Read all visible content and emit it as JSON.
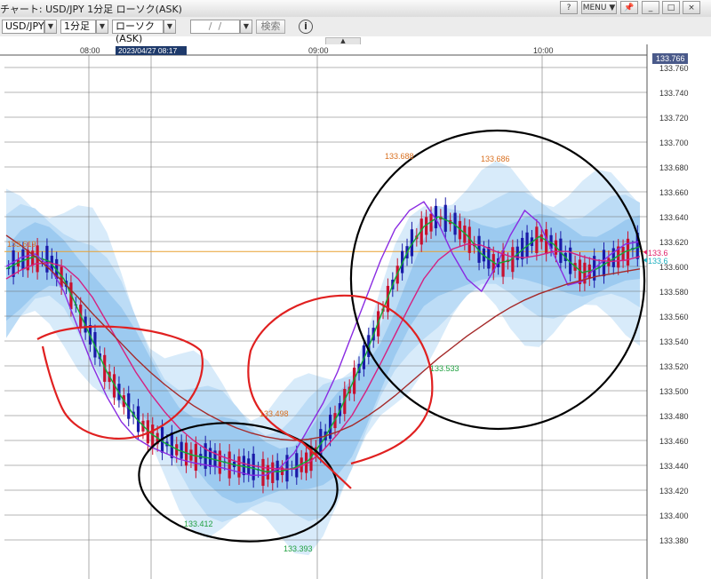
{
  "window": {
    "title": "チャート: USD/JPY 1分足 ローソク(ASK)",
    "help_label": "?",
    "menu_label": "MENU ▼",
    "pin_label": "📌",
    "minimize_label": "_",
    "maximize_label": "□",
    "close_label": "×"
  },
  "toolbar": {
    "pair": "USD/JPY",
    "timeframe": "1分足",
    "candle_type": "ローソク(ASK)",
    "date_value": " /  / ",
    "search_label": "検索",
    "info_label": "i",
    "dropdown_glyph": "▼",
    "collapse_glyph": "▲"
  },
  "chart_data": {
    "type": "candlestick",
    "x_ticks": [
      "08:00",
      "09:00",
      "10:00"
    ],
    "cursor_time": "2023/04/27 08:17",
    "y_ticks": [
      "133.760",
      "133.740",
      "133.720",
      "133.700",
      "133.680",
      "133.660",
      "133.640",
      "133.620",
      "133.600",
      "133.580",
      "133.560",
      "133.540",
      "133.520",
      "133.500",
      "133.480",
      "133.460",
      "133.440",
      "133.420",
      "133.400",
      "133.380"
    ],
    "ylim": [
      133.37,
      133.77
    ],
    "current_price": "133.766",
    "price_tags": [
      "133.6",
      "133.6"
    ],
    "reference_line": 133.612,
    "annotations": {
      "left_level": "133.619",
      "high_1": "133.688",
      "high_2": "133.686",
      "mid_high": "133.498",
      "low_1": "133.412",
      "low_2": "133.393",
      "pullback_low": "133.533"
    },
    "series": [
      {
        "name": "",
        "color": "#11aa33",
        "values": [
          133.598,
          133.604,
          133.608,
          133.604,
          133.59,
          133.565,
          133.54,
          133.515,
          133.495,
          133.478,
          133.466,
          133.458,
          133.452,
          133.448,
          133.446,
          133.443,
          133.44,
          133.438,
          133.435,
          133.435,
          133.438,
          133.444,
          133.46,
          133.48,
          133.505,
          133.53,
          133.56,
          133.59,
          133.615,
          133.632,
          133.64,
          133.635,
          133.625,
          133.61,
          133.602,
          133.605,
          133.615,
          133.624,
          133.618,
          133.605,
          133.595,
          133.598,
          133.605,
          133.612,
          133.616
        ]
      },
      {
        "name": "",
        "color": "#8a2be2",
        "values": [
          133.6,
          133.607,
          133.61,
          133.6,
          133.58,
          133.55,
          133.52,
          133.495,
          133.475,
          133.462,
          133.455,
          133.45,
          133.445,
          133.442,
          133.44,
          133.438,
          133.435,
          133.432,
          133.432,
          133.438,
          133.45,
          133.47,
          133.49,
          133.515,
          133.545,
          133.575,
          133.605,
          133.63,
          133.645,
          133.652,
          133.635,
          133.61,
          133.59,
          133.58,
          133.6,
          133.625,
          133.645,
          133.635,
          133.61,
          133.585,
          133.588,
          133.6,
          133.61,
          133.618,
          133.62
        ]
      },
      {
        "name": "",
        "color": "#d62080",
        "values": [
          133.59,
          133.597,
          133.602,
          133.603,
          133.6,
          133.59,
          133.575,
          133.555,
          133.535,
          133.515,
          133.498,
          133.483,
          133.47,
          133.46,
          133.452,
          133.447,
          133.443,
          133.44,
          133.438,
          133.437,
          133.437,
          133.442,
          133.452,
          133.465,
          133.48,
          133.5,
          133.522,
          133.545,
          133.568,
          133.59,
          133.605,
          133.614,
          133.618,
          133.617,
          133.612,
          133.608,
          133.607,
          133.609,
          133.612,
          133.612,
          133.608,
          133.605,
          133.604,
          133.605,
          133.608
        ]
      },
      {
        "name": "",
        "color": "#a52a2a",
        "values": [
          133.625,
          133.617,
          133.608,
          133.598,
          133.587,
          133.575,
          133.562,
          133.55,
          133.538,
          133.526,
          133.515,
          133.505,
          133.496,
          133.488,
          133.481,
          133.475,
          133.47,
          133.466,
          133.463,
          133.461,
          133.46,
          133.461,
          133.463,
          133.467,
          133.472,
          133.479,
          133.487,
          133.496,
          133.506,
          133.516,
          133.526,
          133.535,
          133.544,
          133.552,
          133.56,
          133.567,
          133.573,
          133.578,
          133.582,
          133.586,
          133.589,
          133.592,
          133.594,
          133.596,
          133.598
        ]
      }
    ]
  }
}
